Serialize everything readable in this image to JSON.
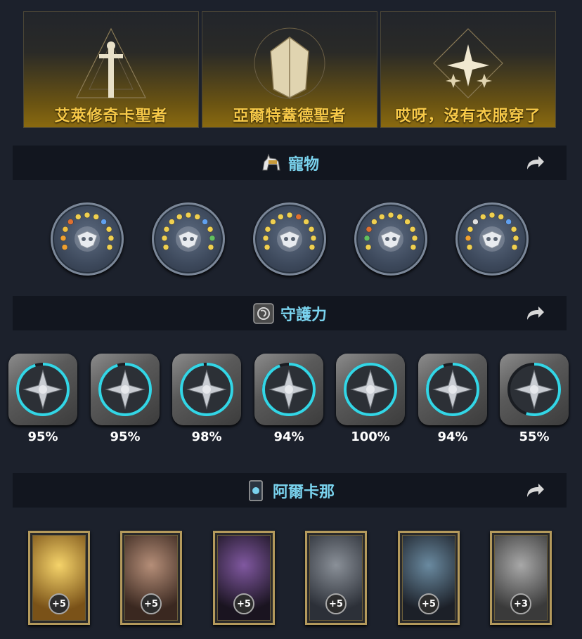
{
  "titles": [
    {
      "name": "艾萊修奇卡聖者",
      "icon": "sword-triangle-emblem"
    },
    {
      "name": "亞爾特蓋德聖者",
      "icon": "winged-shield-emblem"
    },
    {
      "name": "哎呀，沒有衣服穿了",
      "icon": "star-diamond-emblem"
    }
  ],
  "sections": {
    "pets": {
      "title": "寵物",
      "icon": "horse-icon"
    },
    "guardian": {
      "title": "守護力",
      "icon": "guardian-rune-icon"
    },
    "arcana": {
      "title": "阿爾卡那",
      "icon": "tarot-card-icon"
    }
  },
  "pets": [
    {
      "emblem": "owl-mask-icon",
      "dots": [
        "#f0a030",
        "#f0a030",
        "#f0c040",
        "#e07030",
        "#f0d050",
        "#f0d050",
        "#f0d050",
        "#60a0f0",
        "#f0d050",
        "#f0d050",
        "#f0d050"
      ]
    },
    {
      "emblem": "wolf-head-icon",
      "dots": [
        "#f0d050",
        "#f0d050",
        "#f0d050",
        "#f0d050",
        "#f0d050",
        "#f0d050",
        "#f0d050",
        "#60a0f0",
        "#f0d050",
        "#60c060",
        "#f0d050"
      ]
    },
    {
      "emblem": "tree-icon",
      "dots": [
        "#f0d050",
        "#f0d050",
        "#f0d050",
        "#f0d050",
        "#f0d050",
        "#f0d050",
        "#e07030",
        "#f0d050",
        "#f0d050",
        "#f0d050",
        "#f0d050"
      ]
    },
    {
      "emblem": "spiral-sun-icon",
      "dots": [
        "#f0d050",
        "#60c060",
        "#e07030",
        "#f0d050",
        "#f0d050",
        "#f0d050",
        "#f0d050",
        "#f0d050",
        "#f0d050",
        "#f0d050",
        "#f0d050"
      ]
    },
    {
      "emblem": "lotus-star-icon",
      "dots": [
        "#f0d050",
        "#f0a030",
        "#f0d050",
        "#e0e0e0",
        "#f0d050",
        "#f0d050",
        "#f0d050",
        "#60a0f0",
        "#f0d050",
        "#f0d050",
        "#f0d050"
      ]
    }
  ],
  "guardians": [
    {
      "emblem": "shield-sword-icon",
      "percent": "95%",
      "progress": 0.95
    },
    {
      "emblem": "winged-blade-icon",
      "percent": "95%",
      "progress": 0.95
    },
    {
      "emblem": "bow-arrow-icon",
      "percent": "98%",
      "progress": 0.98
    },
    {
      "emblem": "crossed-axes-icon",
      "percent": "94%",
      "progress": 0.94
    },
    {
      "emblem": "radiant-star-icon",
      "percent": "100%",
      "progress": 1.0
    },
    {
      "emblem": "crescent-moon-icon",
      "percent": "94%",
      "progress": 0.94
    },
    {
      "emblem": "scales-icon",
      "percent": "55%",
      "progress": 0.55
    }
  ],
  "arcana": [
    {
      "art": "golden-chalice",
      "level": "+5",
      "colors": [
        "#f5d36a",
        "#7a5218"
      ]
    },
    {
      "art": "ancient-book",
      "level": "+5",
      "colors": [
        "#b58e78",
        "#3a2820"
      ]
    },
    {
      "art": "dark-altar",
      "level": "+5",
      "colors": [
        "#8058a0",
        "#1a1420"
      ]
    },
    {
      "art": "great-bell",
      "level": "+5",
      "colors": [
        "#8a9098",
        "#2c3038"
      ]
    },
    {
      "art": "frozen-mirror",
      "level": "+5",
      "colors": [
        "#6a8aa0",
        "#1c2028"
      ]
    },
    {
      "art": "justice-scales",
      "level": "+3",
      "colors": [
        "#a8a8a8",
        "#3a3a3a"
      ]
    }
  ],
  "colors": {
    "accent": "#7ad3ee",
    "title_gold": "#f7c948",
    "progress_ring": "#33d6e6"
  }
}
